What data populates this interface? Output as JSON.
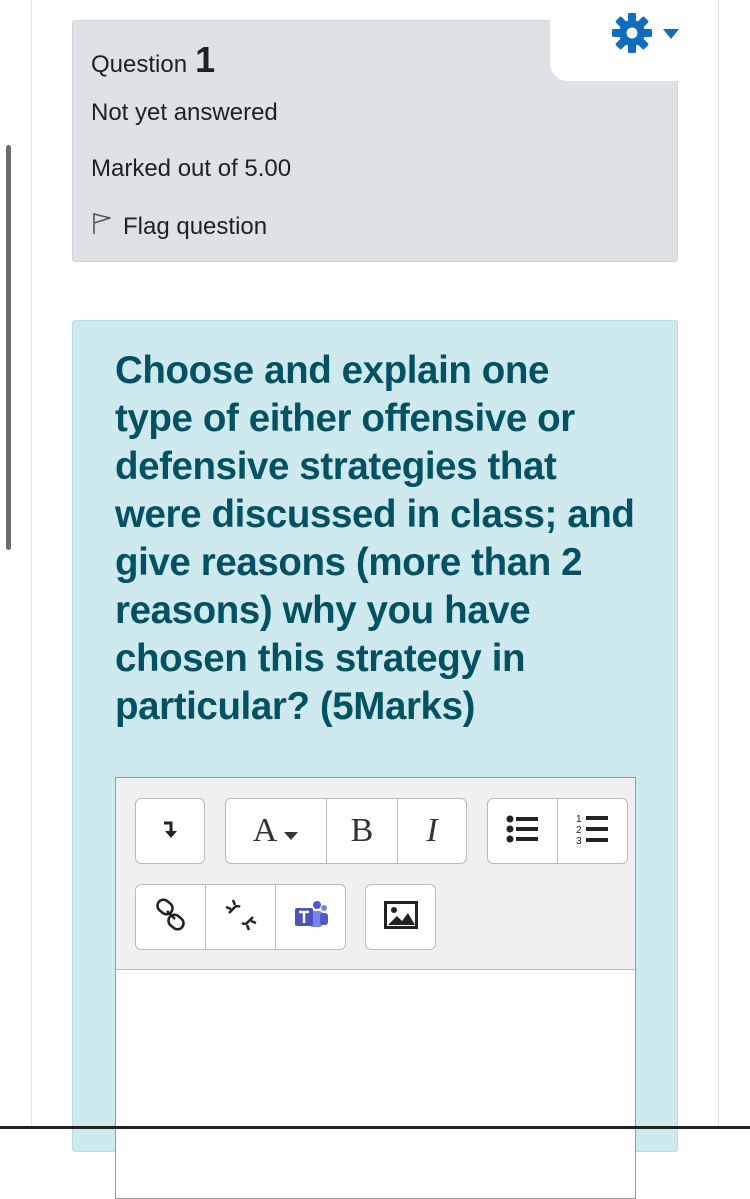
{
  "question": {
    "label": "Question",
    "number": "1",
    "status": "Not yet answered",
    "marks": "Marked out of 5.00",
    "flag_label": "Flag question"
  },
  "question_text": "Choose and explain one type of either offensive or defensive strategies that were discussed in class; and give reasons (more than 2 reasons) why you have chosen this strategy in particular? (5Marks)",
  "editor": {
    "font_button_label": "A",
    "bold_label": "B",
    "italic_label": "I",
    "answer_value": ""
  },
  "icons": [
    "gear-icon",
    "caret-down-icon",
    "flag-icon",
    "collapse-toolbar-icon",
    "unordered-list-icon",
    "ordered-list-icon",
    "link-icon",
    "unlink-icon",
    "teams-icon",
    "image-icon"
  ],
  "colors": {
    "accent": "#0f6cbf",
    "info_bg": "#dee2e6",
    "formulation_bg": "#cfeaef",
    "question_text": "#045163"
  }
}
